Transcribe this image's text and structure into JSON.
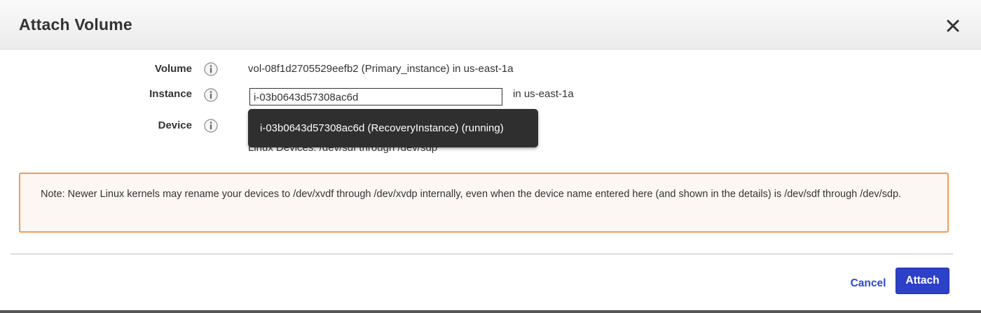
{
  "dialog": {
    "title": "Attach Volume",
    "close_icon": "close-icon"
  },
  "form": {
    "volume": {
      "label": "Volume",
      "info_icon": "info-icon",
      "value": "vol-08f1d2705529eefb2 (Primary_instance) in us-east-1a"
    },
    "instance": {
      "label": "Instance",
      "info_icon": "info-icon",
      "input_value": "i-03b0643d57308ac6d",
      "region_suffix": "in us-east-1a",
      "suggestion": "i-03b0643d57308ac6d (RecoveryInstance) (running)"
    },
    "device": {
      "label": "Device",
      "info_icon": "info-icon",
      "hint": "Linux Devices: /dev/sdf through /dev/sdp"
    }
  },
  "note": {
    "text": "Note: Newer Linux kernels may rename your devices to /dev/xvdf through /dev/xvdp internally, even when the device name entered here (and shown in the details) is /dev/sdf through /dev/sdp."
  },
  "footer": {
    "cancel_label": "Cancel",
    "attach_label": "Attach"
  },
  "colors": {
    "accent": "#2d40c8",
    "link": "#2a49c9",
    "note_border": "#f39a55",
    "tooltip_bg": "#2f2f2f"
  }
}
